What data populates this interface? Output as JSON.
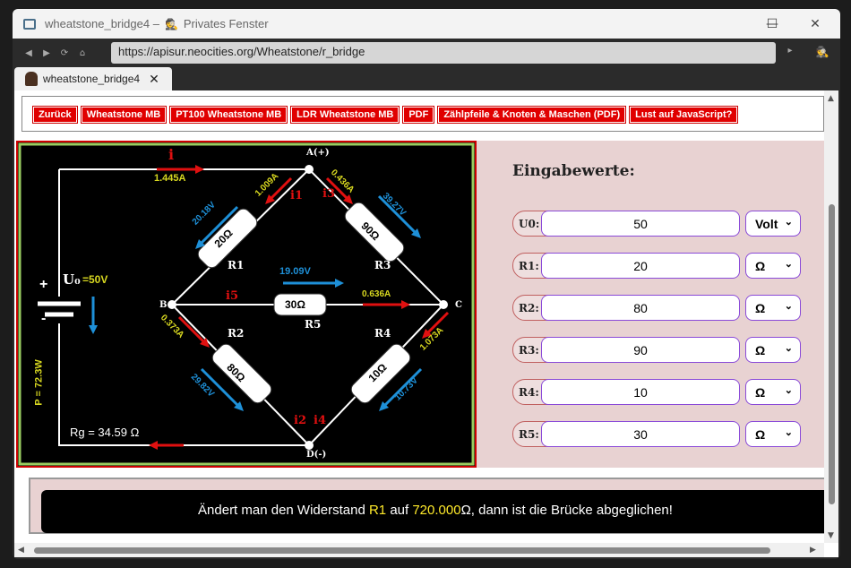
{
  "window": {
    "title": "wheatstone_bridge4 – ",
    "private_label": "Privates Fenster"
  },
  "address_bar": {
    "url": "https://apisur.neocities.org/Wheatstone/r_bridge"
  },
  "tab": {
    "label": "wheatstone_bridge4"
  },
  "nav_links": [
    "Zurück",
    "Wheatstone MB",
    "PT100 Wheatstone MB",
    "LDR Wheatstone MB",
    "PDF",
    "Zählpfeile & Knoten & Maschen (PDF)",
    "Lust auf JavaScript?"
  ],
  "circuit": {
    "node_a": "A(+)",
    "node_b": "B",
    "node_c": "C",
    "node_d": "D(-)",
    "i_s": "1.445A",
    "i1": "1.009A",
    "i3": "0.436A",
    "i2": "0.373A",
    "i4": "1.073A",
    "i5": "0.636A",
    "r1_value": "20Ω",
    "r1_label": "R1",
    "r1_voltage": "20.18V",
    "r2_value": "80Ω",
    "r2_label": "R2",
    "r2_voltage": "29.82V",
    "r3_value": "90Ω",
    "r3_label": "R3",
    "r3_voltage": "39.27V",
    "r4_value": "10Ω",
    "r4_label": "R4",
    "r4_voltage": "10.73V",
    "r5_value": "30Ω",
    "r5_label": "R5",
    "r5_voltage": "19.09V",
    "u0_label": "U₀",
    "u0_value": "=50V",
    "power": "P = 72.3W",
    "rg": "Rg = 34.59 Ω",
    "plus": "+",
    "minus": "-",
    "sym_is": "i",
    "sym_i1": "i1",
    "sym_i3": "i3",
    "sym_i5": "i5",
    "sym_i2": "i2",
    "sym_i4": "i4"
  },
  "inputs": {
    "heading": "Eingabewerte:",
    "rows": [
      {
        "label": "U0:",
        "value": "50",
        "unit": "Volt"
      },
      {
        "label": "R1:",
        "value": "20",
        "unit": "Ω"
      },
      {
        "label": "R2:",
        "value": "80",
        "unit": "Ω"
      },
      {
        "label": "R3:",
        "value": "90",
        "unit": "Ω"
      },
      {
        "label": "R4:",
        "value": "10",
        "unit": "Ω"
      },
      {
        "label": "R5:",
        "value": "30",
        "unit": "Ω"
      }
    ]
  },
  "result": {
    "part1": "Ändert man den Widerstand ",
    "resistor": "R1",
    "part2": " auf ",
    "value": "720.000",
    "part3": "Ω, dann ist die Brücke abgeglichen!"
  },
  "colors": {
    "wire": "#ffffff",
    "current": "#e01010",
    "voltage": "#1e90d8",
    "label_yellow": "#d8d820",
    "frame_green": "#9acd60"
  }
}
